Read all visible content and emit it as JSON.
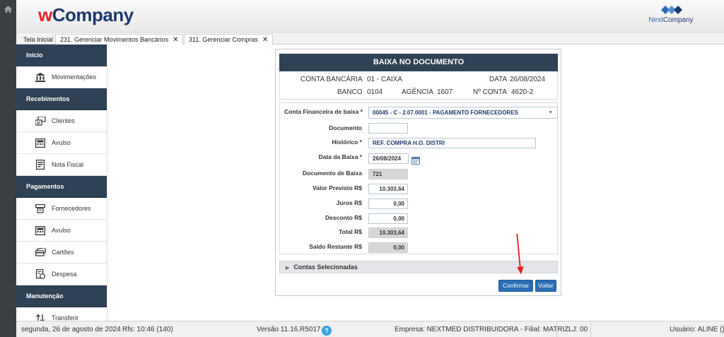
{
  "header": {
    "logo_prefix": "w",
    "logo_main": "Company",
    "brand_right_a": "Next",
    "brand_right_b": "Company"
  },
  "tabs": [
    {
      "label": "Tela Inicial",
      "closable": false
    },
    {
      "label": "231. Gerenciar Movimentos Bancários",
      "close": "✕"
    },
    {
      "label": "311. Gerenciar Compras",
      "close": "✕"
    }
  ],
  "sidebar": {
    "sections": [
      {
        "title": "Início",
        "items": [
          {
            "label": "Movimentações",
            "icon": "bank-icon"
          }
        ]
      },
      {
        "title": "Recebimentos",
        "items": [
          {
            "label": "Clientes",
            "icon": "clients-icon"
          },
          {
            "label": "Avulso",
            "icon": "cash-register-icon"
          },
          {
            "label": "Nota Fiscal",
            "icon": "invoice-icon"
          }
        ]
      },
      {
        "title": "Pagamentos",
        "items": [
          {
            "label": "Fornecedores",
            "icon": "suppliers-icon"
          },
          {
            "label": "Avulso",
            "icon": "cash-register-icon"
          },
          {
            "label": "Cartões",
            "icon": "cards-icon"
          },
          {
            "label": "Despesa",
            "icon": "expense-icon"
          }
        ]
      },
      {
        "title": "Manutenção",
        "items": [
          {
            "label": "Transferir",
            "icon": "transfer-icon"
          }
        ]
      }
    ]
  },
  "panel": {
    "title": "BAIXA NO DOCUMENTO",
    "conta_label": "CONTA BANCÁRIA",
    "conta_value": "01 - CAIXA",
    "data_label": "DATA",
    "data_value": "26/08/2024",
    "banco_label": "BANCO",
    "banco_value": "0104",
    "agencia_label": "AGÊNCIA",
    "agencia_value": "1607",
    "nconta_label": "Nº CONTA",
    "nconta_value": "4620-2"
  },
  "form": {
    "conta_financeira_label": "Conta Financeira de baixa *",
    "conta_financeira_value": "00045 - C - 2.07.0001 - PAGAMENTO FORNECEDORES",
    "documento_label": "Documento",
    "documento_value": "",
    "historico_label": "Histórico *",
    "historico_value": "REF. COMPRA H.O. DISTRI",
    "data_baixa_label": "Data da Baixa *",
    "data_baixa_value": "26/08/2024",
    "doc_baixa_label": "Documento de Baixa",
    "doc_baixa_value": "721",
    "valor_previsto_label": "Valor Previsto R$",
    "valor_previsto_value": "10.303,64",
    "juros_label": "Juros R$",
    "juros_value": "0,00",
    "desconto_label": "Desconto R$",
    "desconto_value": "0,00",
    "total_label": "Total R$",
    "total_value": "10.303,64",
    "saldo_label": "Saldo Restante R$",
    "saldo_value": "0,00"
  },
  "contas_selecionadas": "Contas Selecionadas",
  "buttons": {
    "confirmar": "Confirmar",
    "voltar": "Voltar"
  },
  "status": {
    "date": "segunda, 26 de agosto de 2024",
    "rfs": "Rfs: 10:46 (140)",
    "version": "Versão 11.16.R5017",
    "help": "?",
    "empresa": "Empresa: NEXTMED DISTRIBUIDORA - Filial: MATRIZ",
    "lj": "LJ: 00",
    "usuario": "Usuário: ALINE ()"
  },
  "colors": {
    "navy": "#2f4154",
    "accent": "#2a6fb5",
    "annotation": "#e8212a"
  }
}
